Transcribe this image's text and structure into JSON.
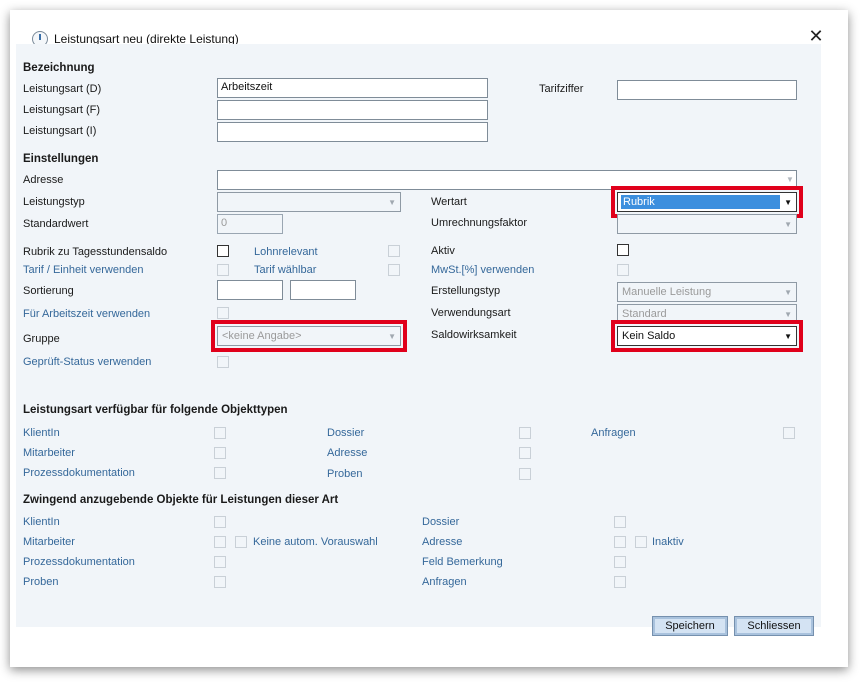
{
  "window": {
    "title": "Leistungsart neu (direkte Leistung)",
    "close_glyph": "✕"
  },
  "bezeichnung": {
    "header": "Bezeichnung",
    "leistungsart_d_label": "Leistungsart (D)",
    "leistungsart_d_value": "Arbeitszeit",
    "leistungsart_f_label": "Leistungsart (F)",
    "leistungsart_i_label": "Leistungsart (I)",
    "tarifziffer_label": "Tarifziffer"
  },
  "einstellungen": {
    "header": "Einstellungen",
    "adresse_label": "Adresse",
    "leistungstyp_label": "Leistungstyp",
    "wertart_label": "Wertart",
    "wertart_value": "Rubrik",
    "standardwert_label": "Standardwert",
    "standardwert_value": "0",
    "umrechnungsfaktor_label": "Umrechnungsfaktor",
    "rubrik_label": "Rubrik zu Tagesstundensaldo",
    "lohnrelevant_label": "Lohnrelevant",
    "aktiv_label": "Aktiv",
    "tarif_einheit_label": "Tarif / Einheit verwenden",
    "tarif_waehlbar_label": "Tarif wählbar",
    "mwst_label": "MwSt.[%] verwenden",
    "sortierung_label": "Sortierung",
    "erstellungstyp_label": "Erstellungstyp",
    "erstellungstyp_value": "Manuelle Leistung",
    "arbeitszeit_label": "Für Arbeitszeit verwenden",
    "verwendungsart_label": "Verwendungsart",
    "verwendungsart_value": "Standard",
    "gruppe_label": "Gruppe",
    "gruppe_value": "<keine Angabe>",
    "saldo_label": "Saldowirksamkeit",
    "saldo_value": "Kein Saldo",
    "geprueft_label": "Geprüft-Status verwenden"
  },
  "objekttypen": {
    "header": "Leistungsart verfügbar für folgende Objekttypen",
    "klientin": "KlientIn",
    "mitarbeiter": "Mitarbeiter",
    "prozessdokumentation": "Prozessdokumentation",
    "dossier": "Dossier",
    "adresse": "Adresse",
    "proben": "Proben",
    "anfragen": "Anfragen"
  },
  "zwingend": {
    "header": "Zwingend anzugebende Objekte für Leistungen dieser Art",
    "klientin": "KlientIn",
    "mitarbeiter": "Mitarbeiter",
    "keine_autom": "Keine autom. Vorauswahl",
    "prozessdokumentation": "Prozessdokumentation",
    "proben": "Proben",
    "dossier": "Dossier",
    "adresse": "Adresse",
    "inaktiv": "Inaktiv",
    "feld_bemerkung": "Feld Bemerkung",
    "anfragen": "Anfragen"
  },
  "buttons": {
    "save": "Speichern",
    "close": "Schliessen"
  },
  "icons": {
    "dropdown_arrow": "▼",
    "app_icon": "clock-icon"
  },
  "colors": {
    "highlight": "#e0001b",
    "selection": "#3c8fde",
    "panel": "#f1f5f9",
    "link_label": "#35689a"
  }
}
